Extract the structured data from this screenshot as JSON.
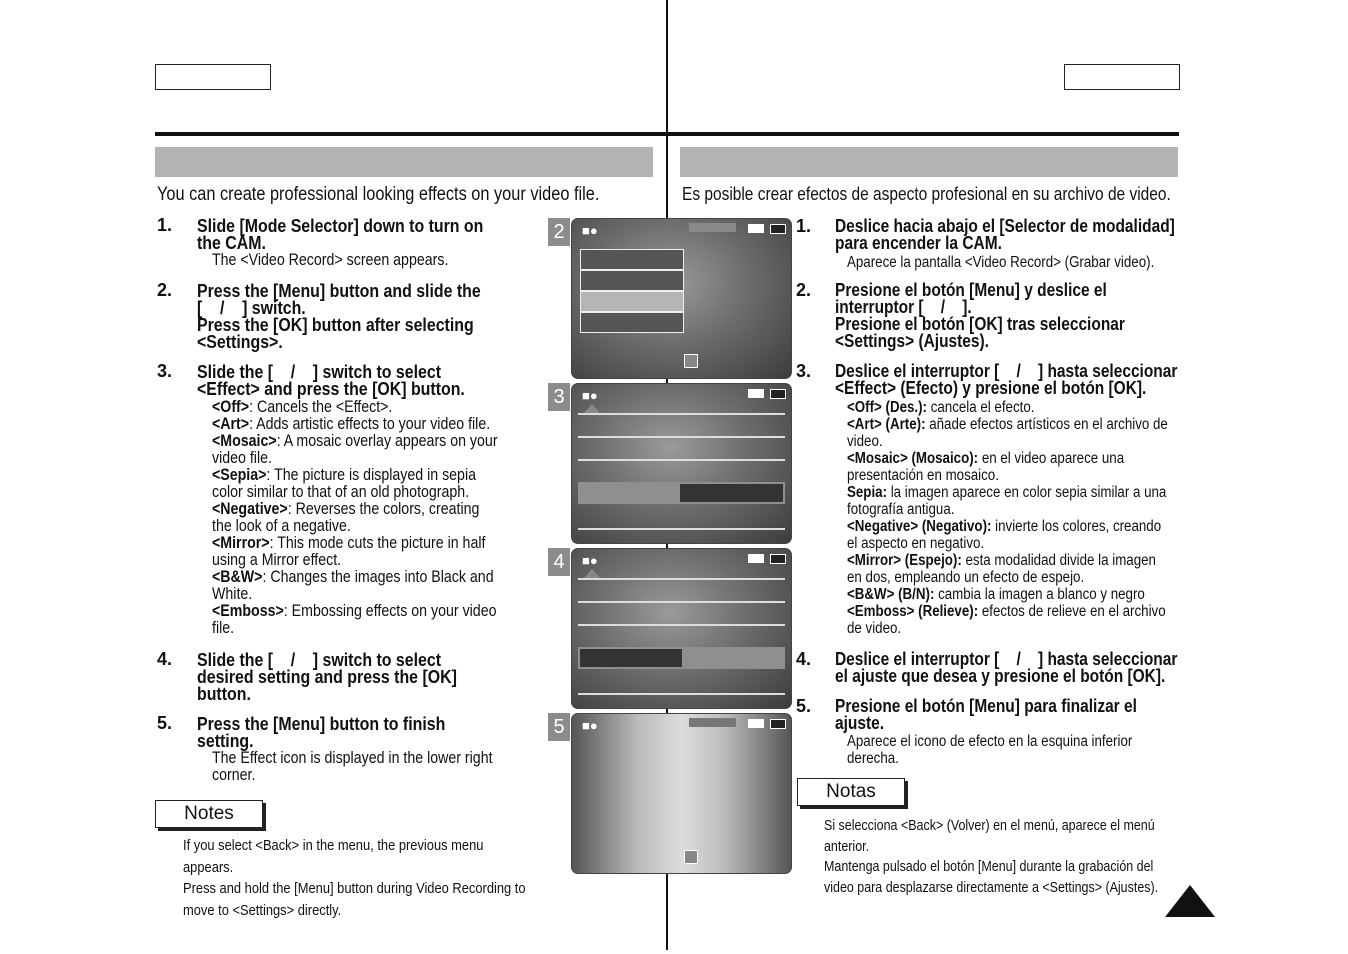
{
  "english": {
    "intro": "You can create professional looking effects on your video file.",
    "steps": [
      {
        "num": "1.",
        "title": "Slide [Mode Selector] down to turn on\nthe CAM.",
        "sub": "The <Video Record> screen appears."
      },
      {
        "num": "2.",
        "title": "Press the [Menu] button and slide the\n[    /    ] switch.\nPress the [OK] button after selecting\n<Settings>."
      },
      {
        "num": "3.",
        "title": "Slide the [    /    ] switch to select\n<Effect> and press the [OK] button."
      },
      {
        "num": "4.",
        "title": "Slide the [    /    ] switch to select\ndesired setting and press the [OK]\nbutton."
      },
      {
        "num": "5.",
        "title": "Press the [Menu] button to finish\nsetting.",
        "sub": "The Effect icon is displayed in the lower right\ncorner."
      }
    ],
    "effects": [
      {
        "term": "<Off>",
        "text": ": Cancels the <Effect>."
      },
      {
        "term": "<Art>",
        "text": ": Adds artistic effects to your video file."
      },
      {
        "term": "<Mosaic>",
        "text": ": A mosaic overlay appears on your\nvideo file."
      },
      {
        "term": "<Sepia>",
        "text": ": The picture is displayed in sepia\ncolor similar to that of an old photograph."
      },
      {
        "term": "<Negative>",
        "text": ": Reverses the colors, creating\nthe look of a negative."
      },
      {
        "term": "<Mirror>",
        "text": ": This mode cuts the picture in half\nusing a Mirror effect."
      },
      {
        "term": "<B&W>",
        "text": ": Changes the images into Black and\nWhite."
      },
      {
        "term": "<Emboss>",
        "text": ": Embossing effects on your video\nfile."
      }
    ],
    "notes_label": "Notes",
    "notes": "If you select <Back> in the menu, the previous menu\nappears.\nPress and hold the [Menu] button during Video Recording to\nmove to <Settings> directly."
  },
  "spanish": {
    "intro": "Es posible crear efectos de aspecto profesional en su archivo de video.",
    "steps": [
      {
        "num": "1.",
        "title": "Deslice hacia abajo el [Selector de modalidad]\npara encender la CAM.",
        "sub": "Aparece la pantalla <Video Record> (Grabar video)."
      },
      {
        "num": "2.",
        "title": "Presione el botón [Menu] y deslice el\ninterruptor [    /    ].\nPresione el botón [OK] tras seleccionar\n<Settings> (Ajustes)."
      },
      {
        "num": "3.",
        "title": "Deslice el interruptor [    /    ] hasta seleccionar\n<Effect> (Efecto) y presione el botón [OK]."
      },
      {
        "num": "4.",
        "title": "Deslice el interruptor [    /    ] hasta seleccionar\nel ajuste que desea y presione el botón [OK]."
      },
      {
        "num": "5.",
        "title": "Presione el botón [Menu] para finalizar el\najuste.",
        "sub": "Aparece el icono de efecto en la esquina inferior\nderecha."
      }
    ],
    "effects": [
      {
        "term": "<Off> (Des.):",
        "text": " cancela el efecto."
      },
      {
        "term": "<Art> (Arte):",
        "text": " añade efectos artísticos en el archivo de\nvideo."
      },
      {
        "term": "<Mosaic> (Mosaico):",
        "text": " en el video aparece una\npresentación en mosaico."
      },
      {
        "term": "Sepia:",
        "text": " la imagen aparece en color sepia similar a una\nfotografía antigua."
      },
      {
        "term": "<Negative> (Negativo):",
        "text": " invierte los colores, creando\nel aspecto en negativo."
      },
      {
        "term": "<Mirror> (Espejo):",
        "text": " esta modalidad divide la imagen\nen dos, empleando un efecto de espejo."
      },
      {
        "term": "<B&W> (B/N):",
        "text": " cambia la imagen a blanco y negro"
      },
      {
        "term": "<Emboss> (Relieve):",
        "text": " efectos de relieve en el archivo\nde video."
      }
    ],
    "notes_label": "Notas",
    "notes": "Si selecciona <Back> (Volver) en el menú, aparece el menú\nanterior.\nMantenga pulsado el botón [Menu] durante la grabación del\nvideo para desplazarse directamente a <Settings> (Ajustes)."
  },
  "screens": [
    "2",
    "3",
    "4",
    "5"
  ],
  "icons": {
    "camera": "video-camera-icon",
    "battery": "battery-icon",
    "memory": "memory-card-icon",
    "page_marker": "triangle-icon"
  }
}
